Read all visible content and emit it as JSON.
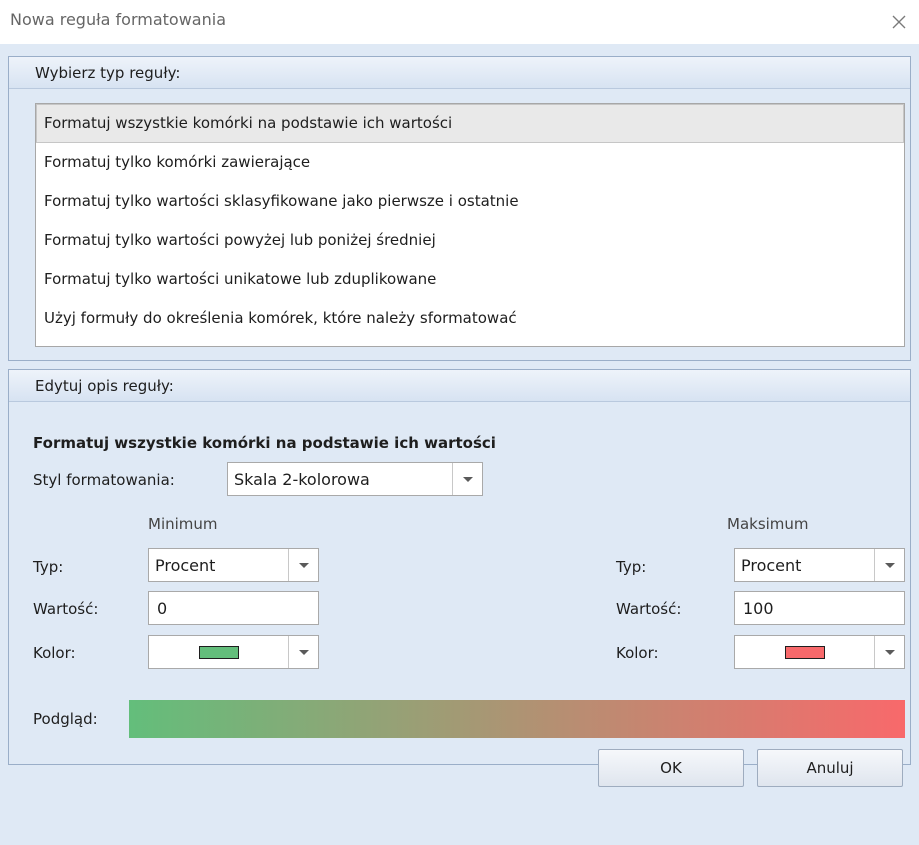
{
  "window": {
    "title": "Nowa reguła formatowania"
  },
  "rule_type": {
    "header": "Wybierz typ reguły:",
    "items": [
      "Formatuj wszystkie komórki na podstawie ich wartości",
      "Formatuj tylko komórki zawierające",
      "Formatuj tylko wartości sklasyfikowane jako pierwsze i ostatnie",
      "Formatuj tylko wartości powyżej lub poniżej średniej",
      "Formatuj tylko wartości unikatowe lub zduplikowane",
      "Użyj formuły do określenia komórek, które należy sformatować"
    ],
    "selected_index": 0
  },
  "description": {
    "header": "Edytuj opis reguły:",
    "title": "Formatuj wszystkie komórki na podstawie ich wartości",
    "style_label": "Styl formatowania:",
    "style_value": "Skala 2-kolorowa",
    "minimum": {
      "heading": "Minimum",
      "type_label": "Typ:",
      "type_value": "Procent",
      "value_label": "Wartość:",
      "value": "0",
      "color_label": "Kolor:",
      "color": "#63be7b"
    },
    "maximum": {
      "heading": "Maksimum",
      "type_label": "Typ:",
      "type_value": "Procent",
      "value_label": "Wartość:",
      "value": "100",
      "color_label": "Kolor:",
      "color": "#f8696b"
    },
    "preview_label": "Podgląd:"
  },
  "buttons": {
    "ok": "OK",
    "cancel": "Anuluj"
  }
}
